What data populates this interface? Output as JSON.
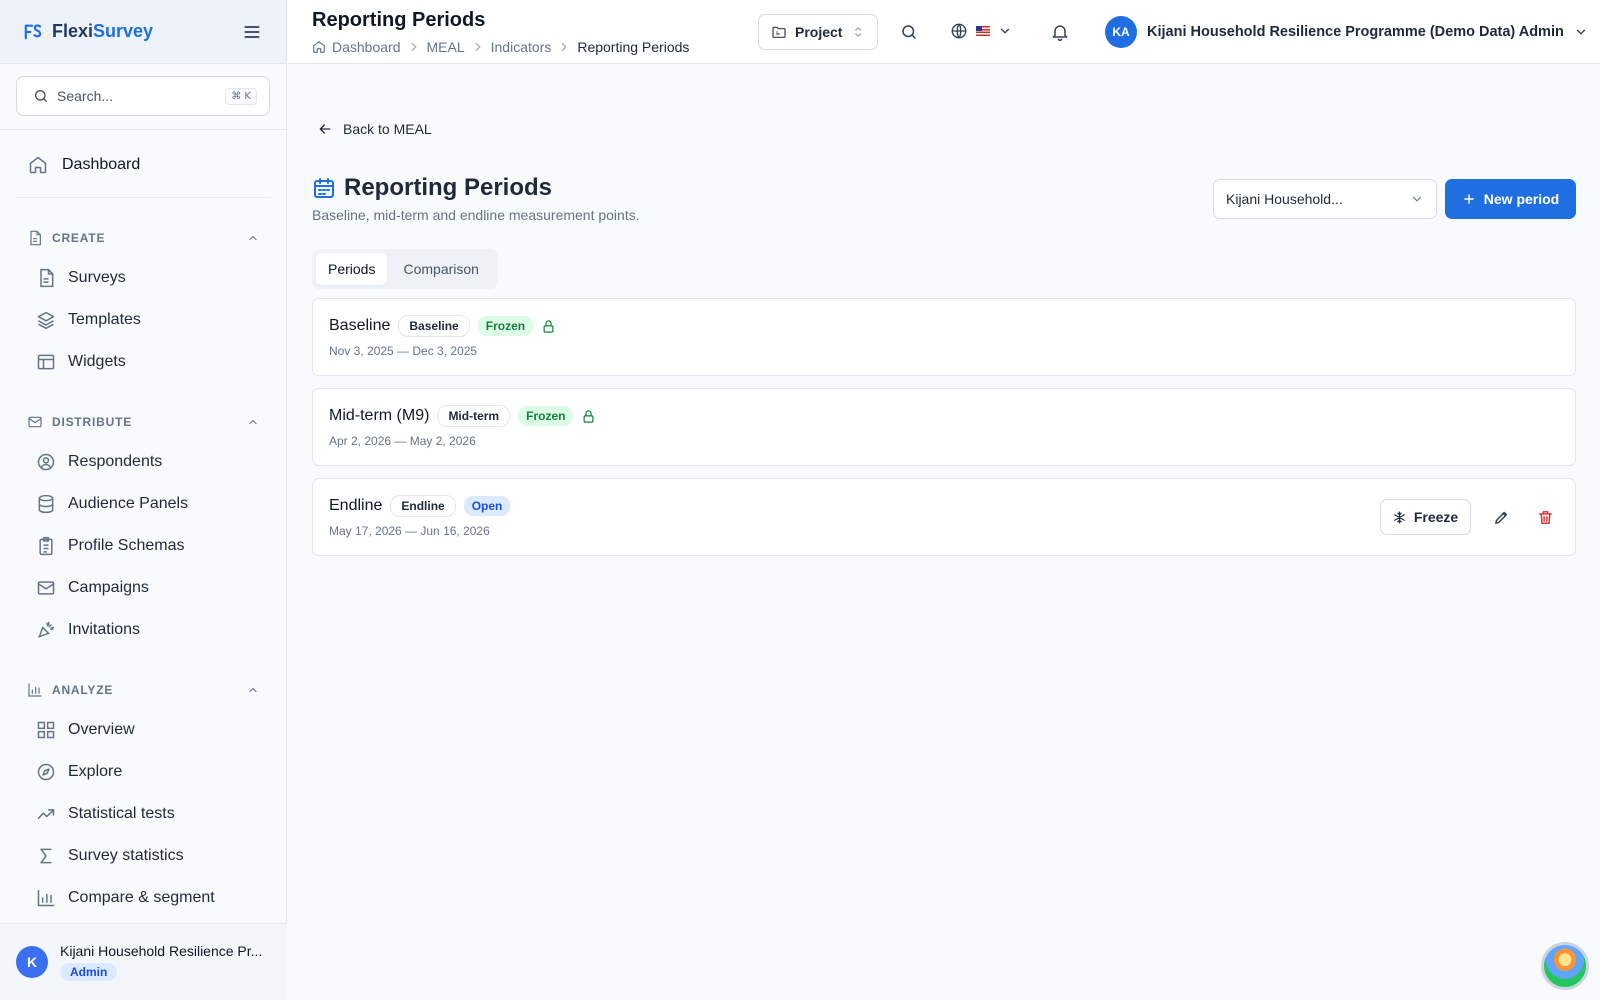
{
  "app": {
    "name_part1": "Flexi",
    "name_part2": "Survey",
    "brand_color": "#1f6fe0"
  },
  "sidebar": {
    "search_placeholder": "Search...",
    "search_shortcut": "⌘ K",
    "dashboard_label": "Dashboard",
    "sections": {
      "create": {
        "title": "CREATE",
        "items": [
          "Surveys",
          "Templates",
          "Widgets"
        ]
      },
      "distribute": {
        "title": "DISTRIBUTE",
        "items": [
          "Respondents",
          "Audience Panels",
          "Profile Schemas",
          "Campaigns",
          "Invitations"
        ]
      },
      "analyze": {
        "title": "ANALYZE",
        "items": [
          "Overview",
          "Explore",
          "Statistical tests",
          "Survey statistics",
          "Compare & segment"
        ]
      }
    },
    "footer": {
      "avatar_initial": "K",
      "name": "Kijani Household Resilience Pr...",
      "role": "Admin"
    }
  },
  "topbar": {
    "title": "Reporting Periods",
    "breadcrumb": [
      "Dashboard",
      "MEAL",
      "Indicators",
      "Reporting Periods"
    ],
    "project_button": "Project",
    "user_initials": "KA",
    "user_name": "Kijani Household Resilience Programme (Demo Data) Admin"
  },
  "page": {
    "back_label": "Back to MEAL",
    "title": "Reporting Periods",
    "subtitle": "Baseline, mid-term and endline measurement points.",
    "project_select_value": "Kijani Household...",
    "new_button": "New period",
    "tabs": [
      {
        "label": "Periods",
        "active": true
      },
      {
        "label": "Comparison",
        "active": false
      }
    ],
    "periods": [
      {
        "name": "Baseline",
        "type": "Baseline",
        "status": "Frozen",
        "dates": "Nov 3, 2025 — Dec 3, 2025"
      },
      {
        "name": "Mid-term (M9)",
        "type": "Mid-term",
        "status": "Frozen",
        "dates": "Apr 2, 2026 — May 2, 2026"
      },
      {
        "name": "Endline",
        "type": "Endline",
        "status": "Open",
        "dates": "May 17, 2026 — Jun 16, 2026",
        "action_label": "Freeze"
      }
    ]
  }
}
